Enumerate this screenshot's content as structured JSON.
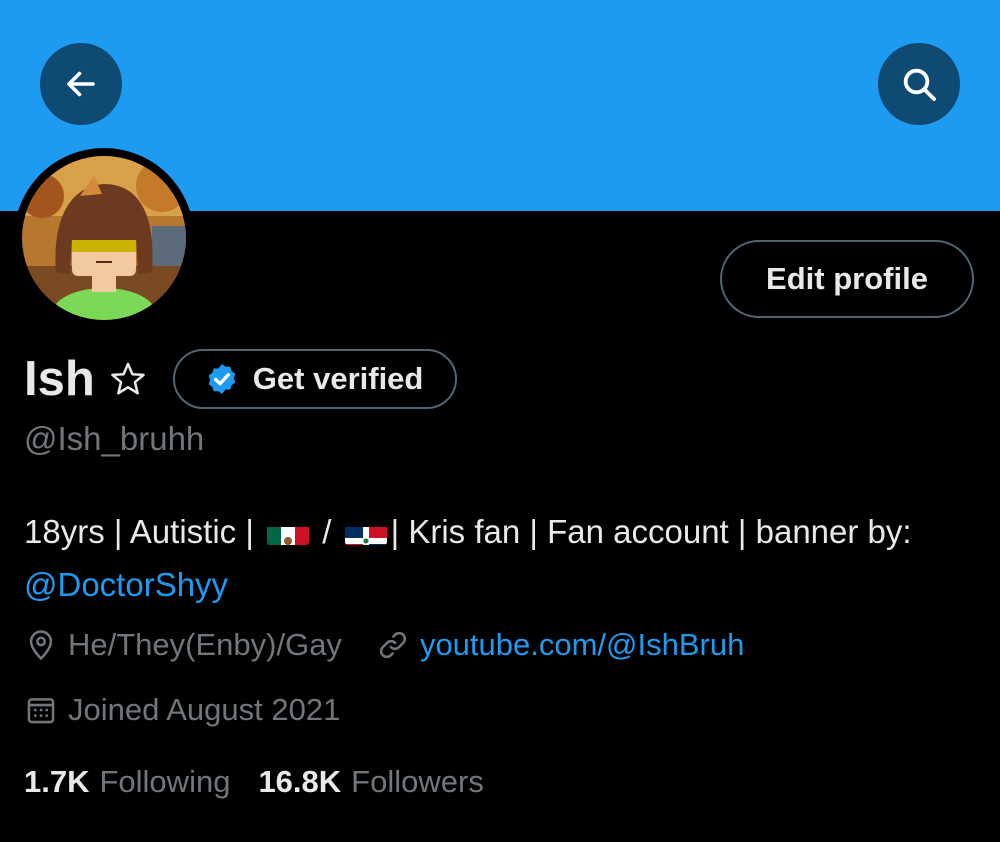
{
  "profile": {
    "name": "Ish",
    "handle": "@Ish_bruhh",
    "get_verified_label": "Get verified",
    "edit_profile_label": "Edit profile",
    "bio_part1": "18yrs | Autistic | ",
    "bio_sep": " / ",
    "bio_part2": "| Kris fan | Fan account | banner by: ",
    "bio_mention": "@DoctorShyy",
    "location": "He/They(Enby)/Gay",
    "website": "youtube.com/@IshBruh",
    "joined": "Joined August 2021",
    "following_count": "1.7K",
    "following_label": "Following",
    "followers_count": "16.8K",
    "followers_label": "Followers"
  },
  "icons": {
    "back": "arrow-left-icon",
    "search": "search-icon",
    "star": "star-outline-icon",
    "verified": "verified-badge-icon",
    "location": "location-pin-icon",
    "link": "link-icon",
    "calendar": "calendar-icon",
    "flag_mexico": "mexico-flag-icon",
    "flag_dominican": "dominican-republic-flag-icon"
  },
  "colors": {
    "banner": "#1d9bf0",
    "background": "#000000",
    "accent": "#1d9bf0",
    "muted_text": "#71767b"
  }
}
